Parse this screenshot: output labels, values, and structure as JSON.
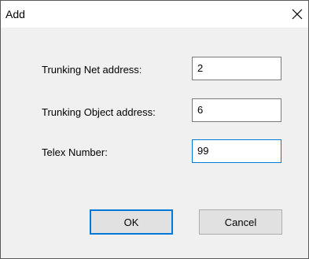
{
  "dialog": {
    "title": "Add",
    "close_icon": "close-icon"
  },
  "fields": [
    {
      "label": "Trunking Net address:",
      "value": "2"
    },
    {
      "label": "Trunking Object address:",
      "value": "6"
    },
    {
      "label": "Telex Number:",
      "value": "99"
    }
  ],
  "buttons": {
    "ok_label": "OK",
    "cancel_label": "Cancel"
  },
  "colors": {
    "accent": "#0078d7",
    "dialog_bg": "#f0f0f0",
    "button_bg": "#e1e1e1"
  }
}
